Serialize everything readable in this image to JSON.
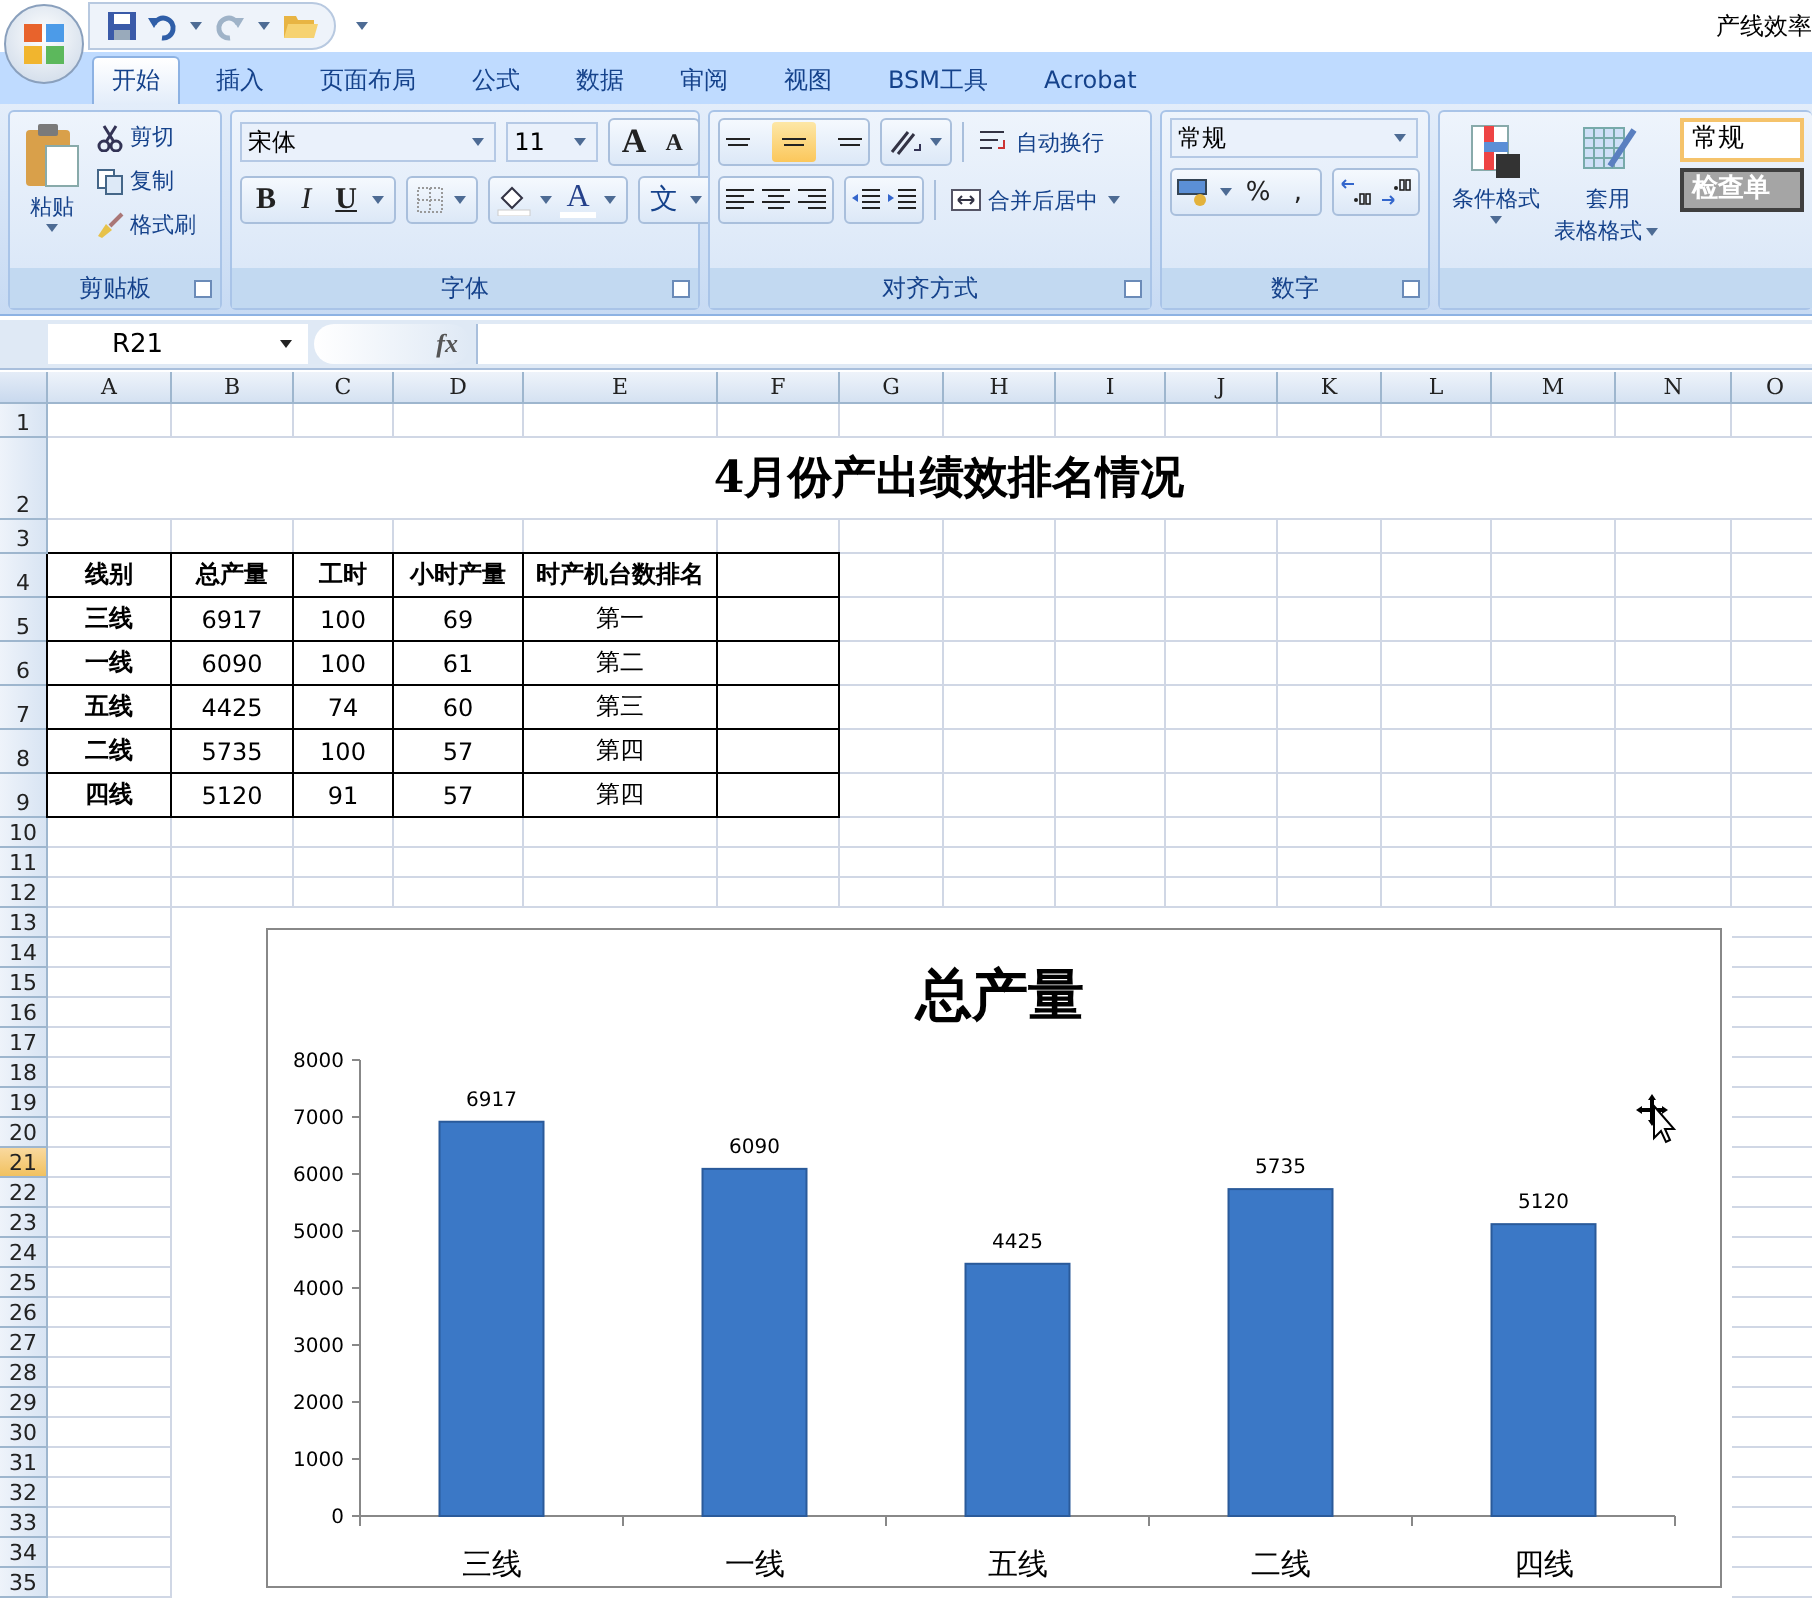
{
  "title_bar": {
    "title": "产线效率"
  },
  "tabs": [
    {
      "label": "开始",
      "selected": true
    },
    {
      "label": "插入",
      "selected": false
    },
    {
      "label": "页面布局",
      "selected": false
    },
    {
      "label": "公式",
      "selected": false
    },
    {
      "label": "数据",
      "selected": false
    },
    {
      "label": "审阅",
      "selected": false
    },
    {
      "label": "视图",
      "selected": false
    },
    {
      "label": "BSM工具",
      "selected": false
    },
    {
      "label": "Acrobat",
      "selected": false
    }
  ],
  "ribbon": {
    "clipboard": {
      "label": "剪贴板",
      "paste": "粘贴",
      "cut": "剪切",
      "copy": "复制",
      "format_painter": "格式刷"
    },
    "font": {
      "label": "字体",
      "font_name": "宋体",
      "font_size": "11",
      "grow_font": "A",
      "shrink_font": "A",
      "bold": "B",
      "italic": "I",
      "underline": "U",
      "font_color": "A",
      "phonetic": "文"
    },
    "alignment": {
      "label": "对齐方式",
      "vertical_align": [
        {
          "selected": false
        },
        {
          "selected": true
        },
        {
          "selected": false
        }
      ],
      "wrap_text": "自动换行",
      "merge_center": "合并后居中"
    },
    "number": {
      "label": "数字",
      "format": "常规",
      "percent": "%",
      "comma": ","
    },
    "styles": {
      "conditional_format": "条件格式",
      "table_format": [
        "套用",
        "表格格式"
      ],
      "cell_styles": [
        "常规",
        "检查单"
      ]
    }
  },
  "formula_bar": {
    "name_box": "R21",
    "fx": "fx"
  },
  "columns": [
    "A",
    "B",
    "C",
    "D",
    "E",
    "F",
    "G",
    "H",
    "I",
    "J",
    "K",
    "L",
    "M",
    "N",
    "O"
  ],
  "rows": [
    {
      "label": "1",
      "selected": false
    },
    {
      "label": "2",
      "selected": false
    },
    {
      "label": "3",
      "selected": false
    },
    {
      "label": "4",
      "selected": false
    },
    {
      "label": "5",
      "selected": false
    },
    {
      "label": "6",
      "selected": false
    },
    {
      "label": "7",
      "selected": false
    },
    {
      "label": "8",
      "selected": false
    },
    {
      "label": "9",
      "selected": false
    },
    {
      "label": "10",
      "selected": false
    },
    {
      "label": "11",
      "selected": false
    },
    {
      "label": "12",
      "selected": false
    },
    {
      "label": "13",
      "selected": false
    },
    {
      "label": "14",
      "selected": false
    },
    {
      "label": "15",
      "selected": false
    },
    {
      "label": "16",
      "selected": false
    },
    {
      "label": "17",
      "selected": false
    },
    {
      "label": "18",
      "selected": false
    },
    {
      "label": "19",
      "selected": false
    },
    {
      "label": "20",
      "selected": false
    },
    {
      "label": "21",
      "selected": true
    },
    {
      "label": "22",
      "selected": false
    },
    {
      "label": "23",
      "selected": false
    },
    {
      "label": "24",
      "selected": false
    },
    {
      "label": "25",
      "selected": false
    },
    {
      "label": "26",
      "selected": false
    },
    {
      "label": "27",
      "selected": false
    },
    {
      "label": "28",
      "selected": false
    },
    {
      "label": "29",
      "selected": false
    },
    {
      "label": "30",
      "selected": false
    },
    {
      "label": "31",
      "selected": false
    },
    {
      "label": "32",
      "selected": false
    },
    {
      "label": "33",
      "selected": false
    },
    {
      "label": "34",
      "selected": false
    },
    {
      "label": "35",
      "selected": false
    }
  ],
  "sheet": {
    "title": "4月份产出绩效排名情况",
    "table": {
      "columns": [
        "线别",
        "总产量",
        "工时",
        "小时产量",
        "时产机台数排名"
      ],
      "rows": [
        [
          "三线",
          "6917",
          "100",
          "69",
          "第一"
        ],
        [
          "一线",
          "6090",
          "100",
          "61",
          "第二"
        ],
        [
          "五线",
          "4425",
          "74",
          "60",
          "第三"
        ],
        [
          "二线",
          "5735",
          "100",
          "57",
          "第四"
        ],
        [
          "四线",
          "5120",
          "91",
          "57",
          "第四"
        ]
      ]
    }
  },
  "chart": {
    "chart_data": {
      "type": "bar",
      "title": "总产量",
      "categories": [
        "三线",
        "一线",
        "五线",
        "二线",
        "四线"
      ],
      "series": [
        {
          "color": "#3b78c6",
          "values": [
            6917,
            6090,
            4425,
            5735,
            5120
          ]
        }
      ],
      "ylim": [
        0,
        8000
      ],
      "yticks": [
        0,
        1000,
        2000,
        3000,
        4000,
        5000,
        6000,
        7000,
        8000
      ],
      "data_labels": true
    }
  }
}
